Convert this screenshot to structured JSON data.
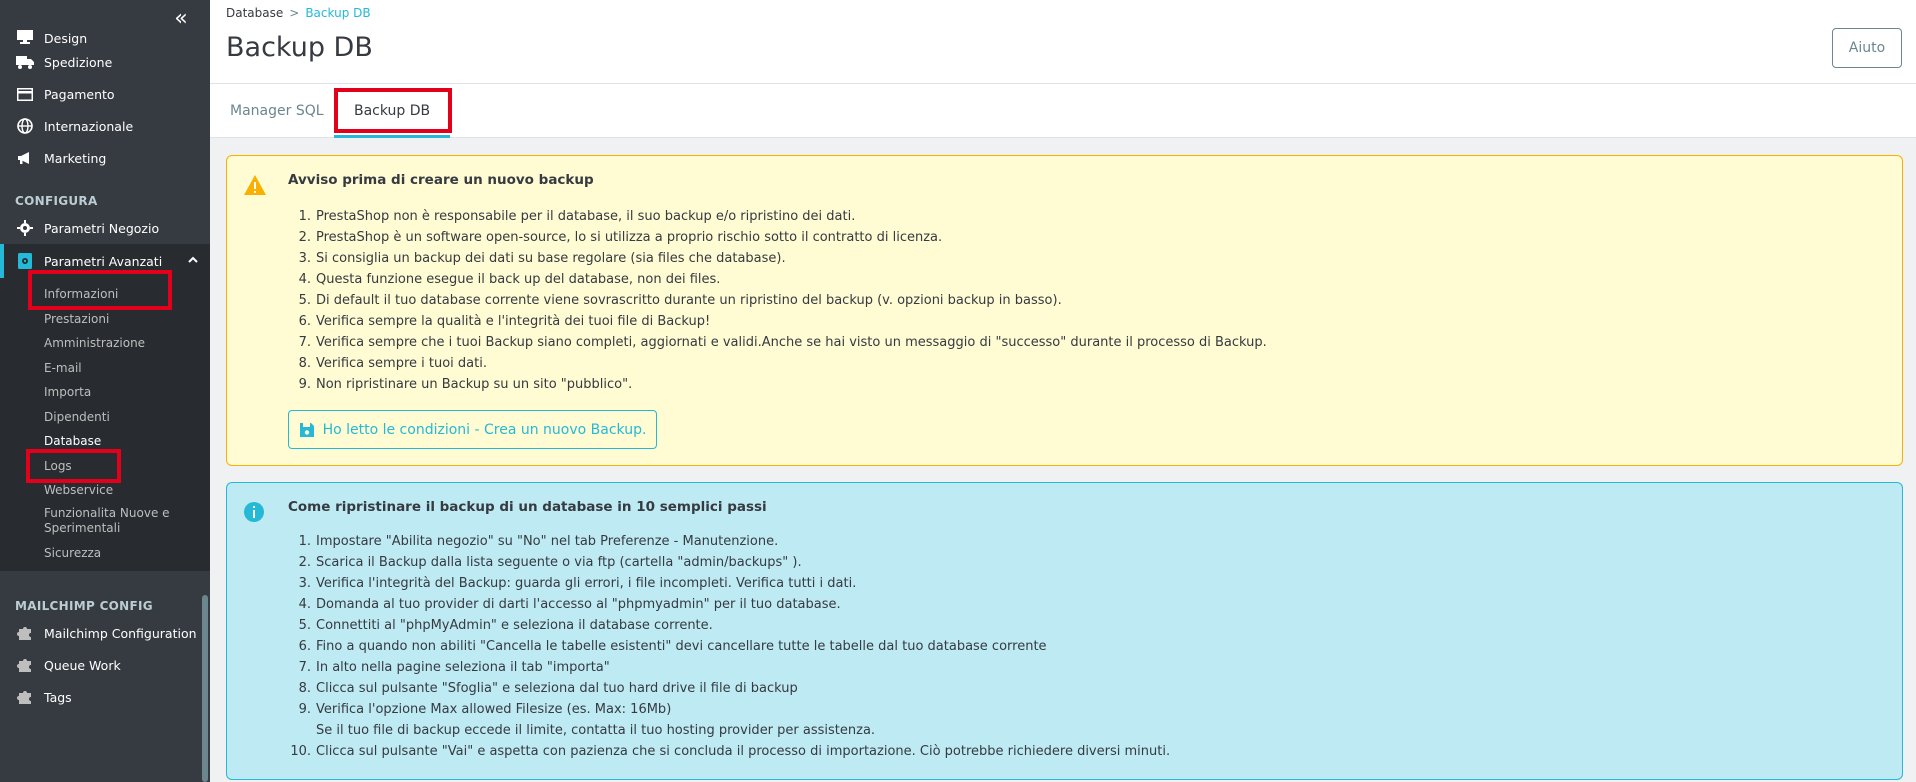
{
  "sidebar": {
    "collapse_icon": "«",
    "top_items": [
      {
        "label": "Design",
        "icon": "monitor-icon"
      },
      {
        "label": "Spedizione",
        "icon": "truck-icon"
      },
      {
        "label": "Pagamento",
        "icon": "credit-card-icon"
      },
      {
        "label": "Internazionale",
        "icon": "globe-icon"
      },
      {
        "label": "Marketing",
        "icon": "megaphone-icon"
      }
    ],
    "section_configura": "CONFIGURA",
    "config_items": [
      {
        "label": "Parametri Negozio",
        "icon": "gear-icon"
      },
      {
        "label": "Parametri Avanzati",
        "icon": "advanced-settings-icon"
      }
    ],
    "submenu": [
      "Informazioni",
      "Prestazioni",
      "Amministrazione",
      "E-mail",
      "Importa",
      "Dipendenti",
      "Database",
      "Logs",
      "Webservice",
      "Funzionalita Nuove e Sperimentali",
      "Sicurezza"
    ],
    "section_mailchimp": "MAILCHIMP CONFIG",
    "mailchimp_items": [
      {
        "label": "Mailchimp Configuration",
        "icon": "puzzle-icon"
      },
      {
        "label": "Queue Work",
        "icon": "puzzle-icon"
      },
      {
        "label": "Tags",
        "icon": "puzzle-icon"
      }
    ]
  },
  "header": {
    "breadcrumb_parent": "Database",
    "breadcrumb_sep": ">",
    "breadcrumb_current": "Backup DB",
    "title": "Backup DB",
    "help_label": "Aiuto"
  },
  "tabs": [
    {
      "label": "Manager SQL"
    },
    {
      "label": "Backup DB"
    }
  ],
  "warning": {
    "title": "Avviso prima di creare un nuovo backup",
    "items": [
      "PrestaShop non è responsabile per il database, il suo backup e/o ripristino dei dati.",
      "PrestaShop è un software open-source, lo si utilizza a proprio rischio sotto il contratto di licenza.",
      "Si consiglia un backup dei dati su base regolare (sia files che database).",
      "Questa funzione esegue il back up del database, non dei files.",
      "Di default il tuo database corrente viene sovrascritto durante un ripristino del backup (v. opzioni backup in basso).",
      "Verifica sempre la qualità e l'integrità dei tuoi file di Backup!",
      "Verifica sempre che i tuoi Backup siano completi, aggiornati e validi.Anche se hai visto un messaggio di \"successo\" durante il processo di Backup.",
      "Verifica sempre i tuoi dati.",
      "Non ripristinare un Backup su un sito \"pubblico\"."
    ],
    "button_label": "Ho letto le condizioni - Crea un nuovo Backup."
  },
  "info": {
    "title": "Come ripristinare il backup di un database in 10 semplici passi",
    "items": [
      "Impostare \"Abilita negozio\" su \"No\" nel tab Preferenze - Manutenzione.",
      "Scarica il Backup dalla lista seguente o via ftp (cartella \"admin/backups\" ).",
      "Verifica l'integrità del Backup: guarda gli errori, i file incompleti. Verifica tutti i dati.",
      "Domanda al tuo provider di darti l'accesso al \"phpmyadmin\" per il tuo database.",
      "Connettiti al \"phpMyAdmin\" e seleziona il database corrente.",
      "Fino a quando non abiliti \"Cancella le tabelle esistenti\" devi cancellare tutte le tabelle dal tuo database corrente",
      "In alto nella pagine seleziona il tab \"importa\"",
      "Clicca sul pulsante \"Sfoglia\" e seleziona dal tuo hard drive il file di backup",
      "Verifica l'opzione Max allowed Filesize (es. Max: 16Mb)",
      "Clicca sul pulsante \"Vai\" e aspetta con pazienza che si concluda il processo di importazione. Ciò potrebbe richiedere diversi minuti."
    ],
    "item9_note": "Se il tuo file di backup eccede il limite, contatta il tuo hosting provider per assistenza."
  },
  "colors": {
    "sidebar_bg": "#363a41",
    "accent": "#25b9d7",
    "warning_bg": "#fffbd3",
    "warning_border": "#fab000",
    "info_bg": "#beeaf3",
    "highlight_red": "#e3001b"
  }
}
